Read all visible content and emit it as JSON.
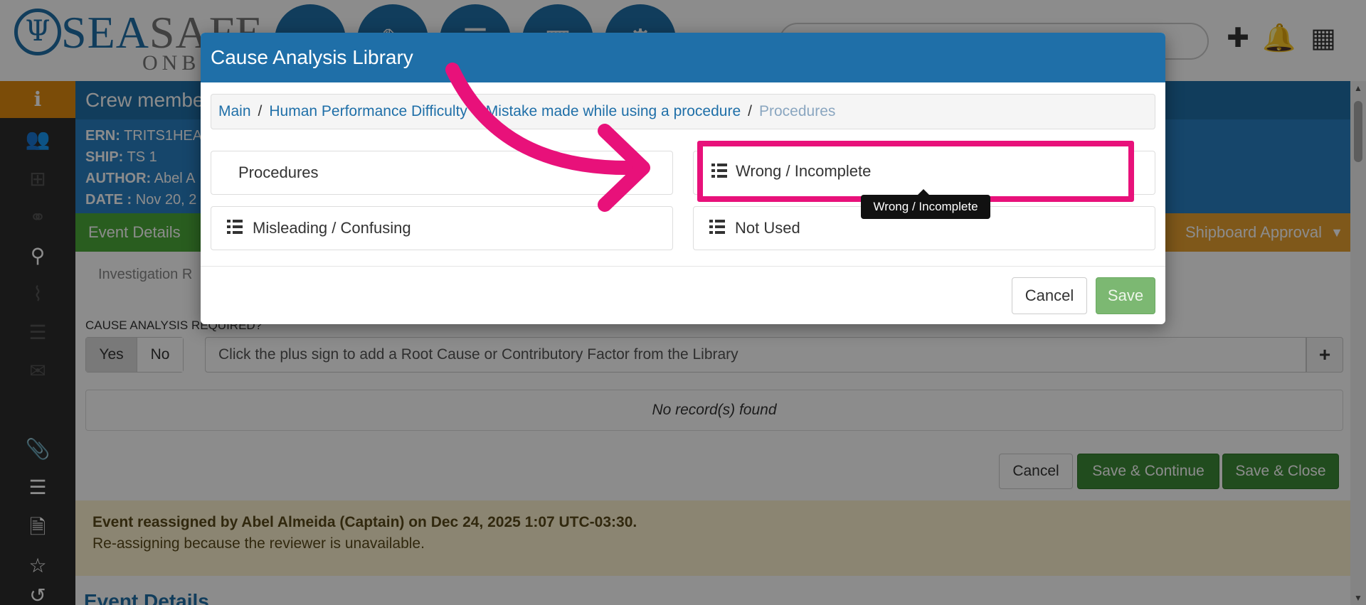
{
  "header": {
    "logo_mark": "Ψ",
    "logo_word_1": "SEA",
    "logo_word_2": "SAFE",
    "logo_sub": "ONBO"
  },
  "page": {
    "crew_banner": "Crew member",
    "info": {
      "ern_label": "ERN:",
      "ern_value": "TRITS1HEA",
      "ship_label": "SHIP:",
      "ship_value": "TS 1",
      "author_label": "AUTHOR:",
      "author_value": "Abel A",
      "date_label": "DATE :",
      "date_value": "Nov 20, 2"
    },
    "tab_event_details": "Event Details",
    "tab_shipboard_approval": "Shipboard Approval",
    "investigation_tab": "Investigation R",
    "cause_required_label": "CAUSE ANALYSIS REQUIRED?",
    "yes_label": "Yes",
    "no_label": "No",
    "root_cause_placeholder": "Click the plus sign to add a Root Cause or Contributory Factor from the Library",
    "plus_label": "+",
    "no_records": "No record(s) found",
    "cancel_label": "Cancel",
    "save_continue_label": "Save & Continue",
    "save_close_label": "Save & Close",
    "notice_bold": "Event reassigned by Abel Almeida (Captain) on Dec 24, 2025 1:07 UTC-03:30.",
    "notice_text": "Re-assigning because the reviewer is unavailable.",
    "event_details_heading": "Event Details"
  },
  "modal": {
    "title": "Cause Analysis Library",
    "breadcrumb": [
      {
        "label": "Main"
      },
      {
        "label": "Human Performance Difficulty"
      },
      {
        "label": "Mistake made while using a procedure"
      },
      {
        "label": "Procedures"
      }
    ],
    "categories": [
      {
        "label": "Procedures"
      },
      {
        "label": "Wrong / Incomplete"
      },
      {
        "label": "Misleading / Confusing"
      },
      {
        "label": "Not Used"
      }
    ],
    "tooltip": "Wrong / Incomplete",
    "cancel_label": "Cancel",
    "save_label": "Save"
  },
  "colors": {
    "brand_blue": "#1f6fa8",
    "highlight": "#e8117a",
    "event_green": "#4caa3a",
    "approval_orange": "#e8a030"
  },
  "icons": {
    "add": "plus-icon",
    "notifications": "bell-icon",
    "apps": "grid-icon",
    "list": "list-icon"
  }
}
